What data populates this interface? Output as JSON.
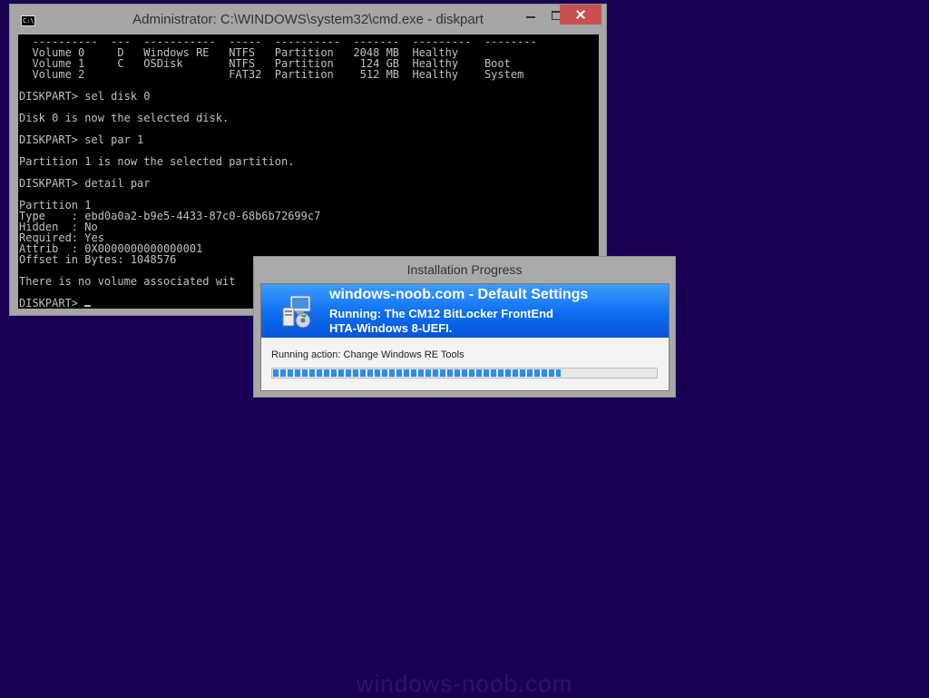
{
  "cmd_window": {
    "title": "Administrator: C:\\WINDOWS\\system32\\cmd.exe - diskpart",
    "icon_text": "C:\\",
    "console_lines": [
      "  ----------  ---  -----------  -----  ----------  -------  ---------  --------",
      "  Volume 0     D   Windows RE   NTFS   Partition   2048 MB  Healthy",
      "  Volume 1     C   OSDisk       NTFS   Partition    124 GB  Healthy    Boot",
      "  Volume 2                      FAT32  Partition    512 MB  Healthy    System",
      "",
      "DISKPART> sel disk 0",
      "",
      "Disk 0 is now the selected disk.",
      "",
      "DISKPART> sel par 1",
      "",
      "Partition 1 is now the selected partition.",
      "",
      "DISKPART> detail par",
      "",
      "Partition 1",
      "Type    : ebd0a0a2-b9e5-4433-87c0-68b6b72699c7",
      "Hidden  : No",
      "Required: Yes",
      "Attrib  : 0X0000000000000001",
      "Offset in Bytes: 1048576",
      "",
      "There is no volume associated wit",
      ""
    ],
    "prompt": "DISKPART> "
  },
  "progress_dialog": {
    "title": "Installation Progress",
    "header_title": "windows-noob.com - Default Settings",
    "header_line1": "Running: The CM12 BitLocker FrontEnd",
    "header_line2": "HTA-Windows 8-UEFI.",
    "action_text": "Running action: Change Windows RE Tools",
    "progress_percent": 75,
    "progress_color": "#2a8ee8",
    "header_color": "#0d6ef0",
    "icon": "setup-computer-icon"
  },
  "desktop": {
    "background_color": "#1a0054",
    "watermark": "windows-noob.com"
  }
}
